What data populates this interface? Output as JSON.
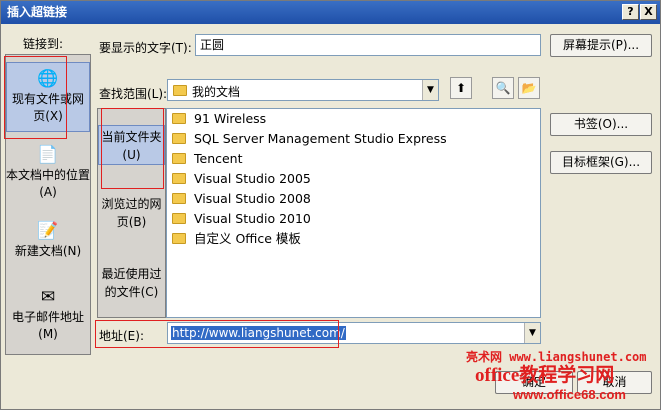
{
  "title": "插入超链接",
  "title_buttons": {
    "help": "?",
    "close": "X"
  },
  "link_to": {
    "label": "链接到:",
    "items": [
      {
        "label": "现有文件或网页(X)",
        "icon": "web-page-icon",
        "selected": true
      },
      {
        "label": "本文档中的位置(A)",
        "icon": "document-place-icon",
        "selected": false
      },
      {
        "label": "新建文档(N)",
        "icon": "new-document-icon",
        "selected": false
      },
      {
        "label": "电子邮件地址(M)",
        "icon": "email-icon",
        "selected": false
      }
    ]
  },
  "display_text": {
    "label": "要显示的文字(T):",
    "value": "正圆"
  },
  "screen_tip_button": "屏幕提示(P)...",
  "look_in": {
    "label": "查找范围(L):",
    "value": "我的文档"
  },
  "side_buttons": {
    "bookmark": "书签(O)...",
    "target_frame": "目标框架(G)..."
  },
  "sub_nav": [
    {
      "label": "当前文件夹(U)",
      "selected": true
    },
    {
      "label": "浏览过的网页(B)",
      "selected": false
    },
    {
      "label": "最近使用过的文件(C)",
      "selected": false
    }
  ],
  "files": [
    "91 Wireless",
    "SQL Server Management Studio Express",
    "Tencent",
    "Visual Studio 2005",
    "Visual Studio 2008",
    "Visual Studio 2010",
    "自定义 Office 模板"
  ],
  "address": {
    "label": "地址(E):",
    "value": "http://www.liangshunet.com/"
  },
  "ok_button": "确定",
  "cancel_button": "取消",
  "watermark": {
    "line1": "亮术网 www.liangshunet.com",
    "line2": "office教程学习网",
    "line3": "www.office68.com"
  },
  "colors": {
    "title_bar": "#1f4fa8",
    "highlight": "#e02020",
    "selection": "#316ac5"
  }
}
